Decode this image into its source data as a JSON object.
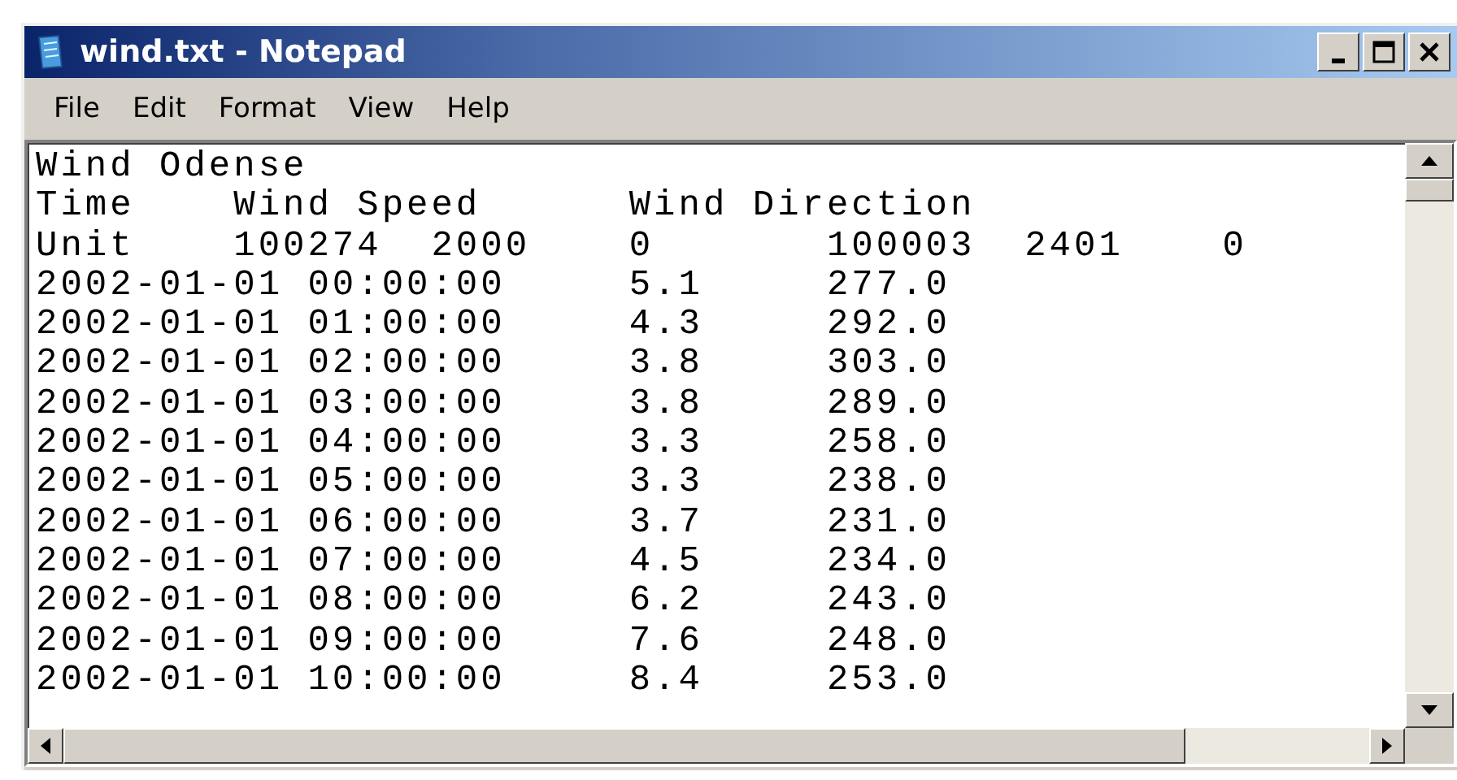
{
  "window": {
    "title": "wind.txt - Notepad"
  },
  "menu": [
    "File",
    "Edit",
    "Format",
    "View",
    "Help"
  ],
  "document": {
    "lines": [
      "Wind Odense",
      "Time    Wind Speed      Wind Direction",
      "Unit    100274  2000    0       100003  2401    0",
      "2002-01-01 00:00:00     5.1     277.0",
      "2002-01-01 01:00:00     4.3     292.0",
      "2002-01-01 02:00:00     3.8     303.0",
      "2002-01-01 03:00:00     3.8     289.0",
      "2002-01-01 04:00:00     3.3     258.0",
      "2002-01-01 05:00:00     3.3     238.0",
      "2002-01-01 06:00:00     3.7     231.0",
      "2002-01-01 07:00:00     4.5     234.0",
      "2002-01-01 08:00:00     6.2     243.0",
      "2002-01-01 09:00:00     7.6     248.0",
      "2002-01-01 10:00:00     8.4     253.0"
    ]
  }
}
